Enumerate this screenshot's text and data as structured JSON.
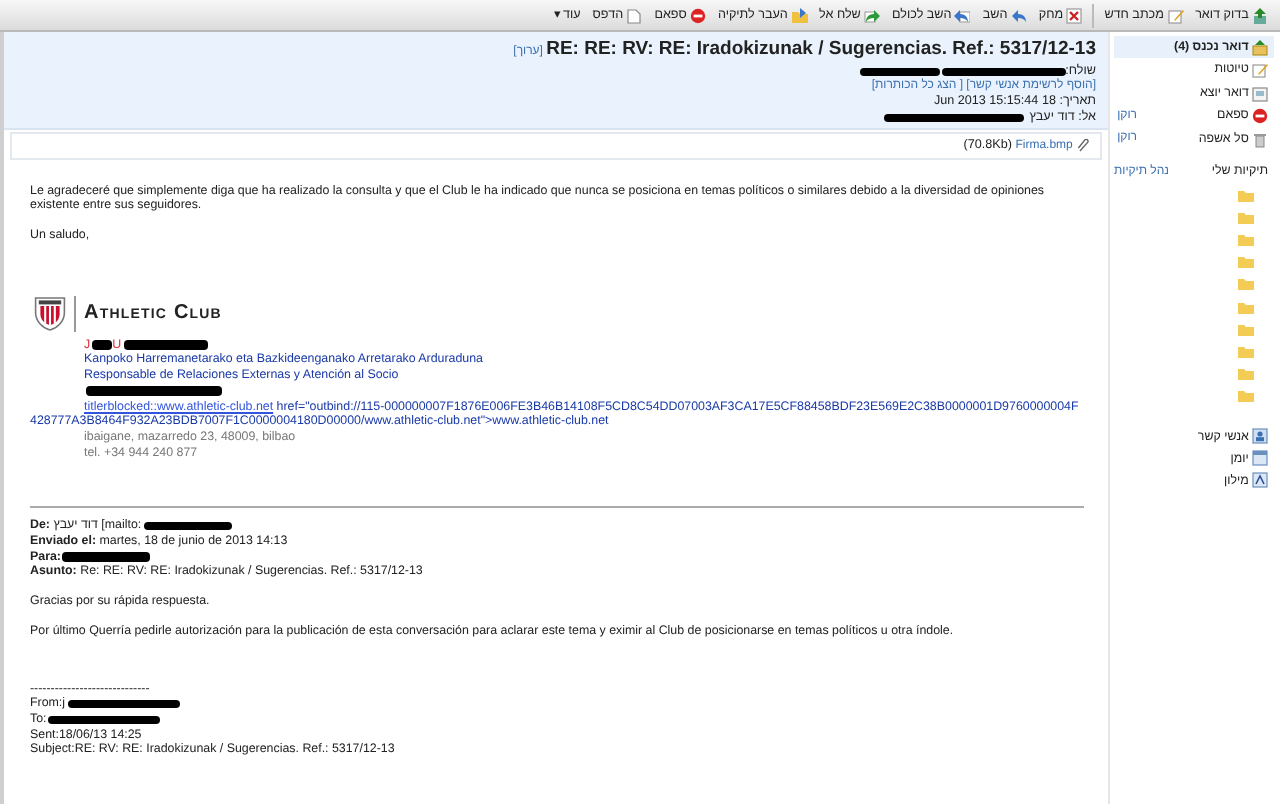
{
  "toolbar": {
    "buttons": [
      {
        "kind": "check_mail",
        "label": "בדוק דואר"
      },
      {
        "kind": "compose",
        "label": "מכתב חדש",
        "group_end": true
      },
      {
        "kind": "delete",
        "label": "מחק"
      },
      {
        "kind": "reply",
        "label": "השב"
      },
      {
        "kind": "reply_all",
        "label": "השב לכולם"
      },
      {
        "kind": "forward",
        "label": "שלח אל"
      },
      {
        "kind": "move",
        "label": "העבר לתיקיה"
      },
      {
        "kind": "spam",
        "label": "ספאם"
      },
      {
        "kind": "print",
        "label": "הדפס"
      },
      {
        "kind": "more",
        "label": "עוד",
        "caret": "▾"
      }
    ]
  },
  "sidebar": {
    "folders": [
      {
        "kind": "inbox",
        "label": "דואר נכנס (4)",
        "selected": true
      },
      {
        "kind": "drafts",
        "label": "טיוטות",
        "selected": false
      },
      {
        "kind": "outbox",
        "label": "דואר יוצא",
        "selected": false
      },
      {
        "kind": "spam",
        "label": "ספאם",
        "selected": false,
        "action": "רוקן"
      },
      {
        "kind": "trash",
        "label": "סל אשפה",
        "selected": false,
        "action": "רוקן"
      }
    ],
    "my_folders": {
      "title": "תיקיות שלי",
      "manage": "נהל תיקיות",
      "items": [
        {
          "kind": "folder"
        },
        {
          "kind": "folder"
        },
        {
          "kind": "folder"
        },
        {
          "kind": "folder"
        },
        {
          "kind": "folder"
        },
        {
          "kind": "folder"
        },
        {
          "kind": "folder"
        },
        {
          "kind": "folder"
        },
        {
          "kind": "folder"
        },
        {
          "kind": "folder"
        }
      ]
    },
    "apps": [
      {
        "kind": "contacts",
        "label": "אנשי קשר"
      },
      {
        "kind": "calendar",
        "label": "יומן"
      },
      {
        "kind": "dictionary",
        "label": "מילון"
      }
    ]
  },
  "message": {
    "subject": "RE: RE: RV: RE: Iradokizunak / Sugerencias. Ref.: 5317/12-13",
    "edit": "[ערוך]",
    "from_label": "שולח:",
    "add_contact": "[הוסף לרשימת אנשי קשר]",
    "show_headers": "[ הצג כל הכותרות]",
    "date": "תאריך: 18 Jun 2013 15:15:44",
    "to_label": "אל: דוד יעבץ",
    "attachment": {
      "name": "Firma.bmp",
      "size": "(70.8Kb)"
    },
    "body": [
      {
        "kind": "para",
        "text": "Le agradeceré que simplemente diga que ha realizado la consulta y que el Club le ha indicado que nunca se posiciona en temas políticos o similares debido a la diversidad de opiniones existente entre sus seguidores."
      },
      {
        "kind": "para",
        "text": "Un saludo,"
      },
      {
        "kind": "logo",
        "text": "Athletic Club"
      },
      {
        "kind": "sig_name",
        "text": "J",
        "text2": "U",
        "redacted": true
      },
      {
        "kind": "sig",
        "text": "Kanpoko Harremanetarako eta Bazkideenganako Arretarako Arduraduna"
      },
      {
        "kind": "sig",
        "text": "Responsable de Relaciones Externas y Atención al Socio"
      },
      {
        "kind": "sig",
        "redacted": true
      },
      {
        "kind": "link_blob",
        "link": "titlerblocked::www.athletic-club.net",
        "text": "href=\"outbind://115-000000007F1876E006FE3B46B14108F5CD8C54DD07003AF3CA17E5CF88458BDF23E569E2C38B0000001D9760000004F428777A3B8464F932A23BDB7007F1C0000004180D00000/www.athletic-club.net\">www.athletic-club.net"
      },
      {
        "kind": "address",
        "text": "ibaigane, mazarredo 23, 48009, bilbao"
      },
      {
        "kind": "address",
        "text": "tel. +34 944 240 877"
      },
      {
        "kind": "rule"
      },
      {
        "kind": "quote_header",
        "text": "**De:** דוד יעבץ [mailto:",
        "redacted": true
      },
      {
        "kind": "quote_header",
        "text": "**Enviado el:** martes, 18 de junio de 2013 14:13"
      },
      {
        "kind": "quote_header",
        "text": "**Para:**",
        "redacted": true
      },
      {
        "kind": "quote_header",
        "text": "**Asunto:** Re: RE: RV: RE: Iradokizunak / Sugerencias. Ref.: 5317/12-13"
      },
      {
        "kind": "para",
        "text": "Gracias por su rápida respuesta."
      },
      {
        "kind": "para",
        "text": "Por último Querría pedirle autorización para la publicación de esta conversación para aclarar este tema y eximir al Club de posicionarse en temas políticos u otra índole."
      },
      {
        "kind": "plain",
        "text": "-----------------------------",
        "gap": true
      },
      {
        "kind": "plain",
        "text": "From:j",
        "redacted": true
      },
      {
        "kind": "plain",
        "text": "To:",
        "redacted": true
      },
      {
        "kind": "plain",
        "text": "Sent:18/06/13 14:25"
      },
      {
        "kind": "plain",
        "text": "Subject:RE: RV: RE: Iradokizunak / Sugerencias. Ref.: 5317/12-13"
      }
    ]
  }
}
